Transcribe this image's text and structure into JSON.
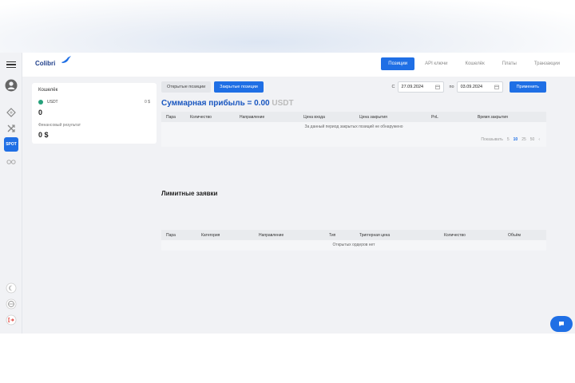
{
  "header": {
    "logo": "Colibri",
    "nav": [
      "Позиции",
      "API ключи",
      "Кошелёк",
      "Платы",
      "Транзакции"
    ],
    "active_nav": 0
  },
  "rail": {
    "futures_badge": "SPOT"
  },
  "wallet": {
    "title": "Кошелёк",
    "currency": "USDT",
    "currency_value": "0 $",
    "balance": "0",
    "referral_label": "Финансовый результат",
    "referral_value": "0 $"
  },
  "positions": {
    "tabs": [
      "Открытые позиции",
      "Закрытые позиции"
    ],
    "active_tab": 1,
    "from_label": "С",
    "from_date": "27.09.2024",
    "to_label": "по",
    "to_date": "03.09.2024",
    "apply": "Применить",
    "summary_label": "Суммарная прибыль = 0.00",
    "summary_unit": "USDT",
    "columns": [
      "Пара",
      "Количество",
      "Направление",
      "Цена входа",
      "Цена закрытия",
      "PnL",
      "Время закрытия"
    ],
    "empty_text": "За данный период закрытых позиций не обнаружено",
    "pager_label": "Показывать",
    "pager_options": [
      "5",
      "10",
      "25",
      "50",
      "‹"
    ]
  },
  "limit_orders": {
    "title": "Лимитные заявки",
    "columns": [
      "Пара",
      "Категория",
      "Направление",
      "Тип",
      "Триггерная цена",
      "Количество",
      "Объём"
    ],
    "empty_text": "Открытых ордеров нет"
  },
  "colors": {
    "accent": "#1f6fe5",
    "usdt": "#26a17b",
    "title_blue": "#1a57c0"
  },
  "icons": [
    "menu-icon",
    "user-icon",
    "diamond-icon",
    "shuffle-icon",
    "glasses-icon",
    "moon-icon",
    "globe-icon",
    "logout-icon",
    "calendar-icon",
    "chat-icon"
  ]
}
